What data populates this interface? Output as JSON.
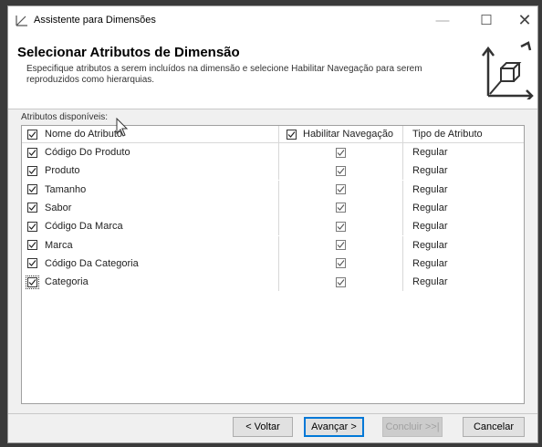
{
  "window": {
    "title": "Assistente para Dimensões",
    "controls": {
      "minimize": "—",
      "maximize": "☐",
      "close": "✕"
    }
  },
  "header": {
    "title": "Selecionar Atributos de Dimensão",
    "description": "Especifique atributos a serem incluídos na dimensão e selecione Habilitar Navegação para serem reproduzidos como hierarquias."
  },
  "attributes": {
    "section_label": "Atributos disponíveis:",
    "columns": {
      "name": "Nome do Atributo",
      "navigation": "Habilitar Navegação",
      "type": "Tipo de Atributo"
    },
    "rows": [
      {
        "name": "Código Do Produto",
        "type": "Regular",
        "included": true,
        "navigation": true
      },
      {
        "name": "Produto",
        "type": "Regular",
        "included": true,
        "navigation": true
      },
      {
        "name": "Tamanho",
        "type": "Regular",
        "included": true,
        "navigation": true
      },
      {
        "name": "Sabor",
        "type": "Regular",
        "included": true,
        "navigation": true
      },
      {
        "name": "Código Da Marca",
        "type": "Regular",
        "included": true,
        "navigation": true
      },
      {
        "name": "Marca",
        "type": "Regular",
        "included": true,
        "navigation": true
      },
      {
        "name": "Código Da Categoria",
        "type": "Regular",
        "included": true,
        "navigation": true
      },
      {
        "name": "Categoria",
        "type": "Regular",
        "included": true,
        "navigation": true
      }
    ]
  },
  "buttons": {
    "back": "< Voltar",
    "next": "Avançar >",
    "finish": "Concluir >>|",
    "cancel": "Cancelar"
  },
  "colors": {
    "accent": "#0078d7",
    "header_bg": "#ffffff",
    "dialog_bg": "#f0f0f0"
  }
}
